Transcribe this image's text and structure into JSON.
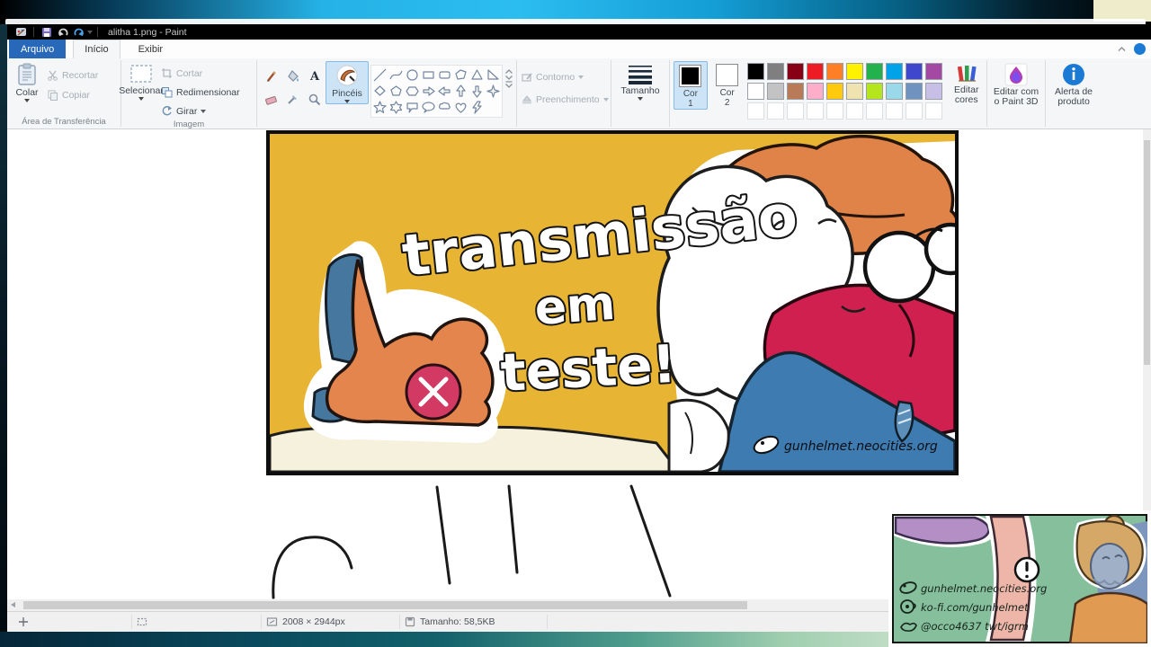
{
  "window": {
    "title": "alitha 1.png - Paint"
  },
  "tabs": {
    "file": "Arquivo",
    "home": "Início",
    "view": "Exibir"
  },
  "ribbon": {
    "clipboard": {
      "group_label": "Área de Transferência",
      "paste": "Colar",
      "cut": "Recortar",
      "copy": "Copiar"
    },
    "image": {
      "group_label": "Imagem",
      "select": "Selecionar",
      "crop": "Cortar",
      "resize": "Redimensionar",
      "rotate": "Girar"
    },
    "brushes": {
      "label": "Pincéis"
    },
    "shapes": {
      "outline": "Contorno",
      "fill": "Preenchimento"
    },
    "size": {
      "label": "Tamanho"
    },
    "colors": {
      "c1_label": "Cor",
      "c1_num": "1",
      "c2_label": "Cor",
      "c2_num": "2",
      "edit_label": "Editar cores",
      "color1": "#000000",
      "color2": "#ffffff",
      "palette": [
        [
          "#000000",
          "#7f7f7f",
          "#880015",
          "#ed1c24",
          "#ff7f27",
          "#fff200",
          "#22b14c",
          "#00a2e8",
          "#3f48cc",
          "#a349a4"
        ],
        [
          "#ffffff",
          "#c3c3c3",
          "#b97a57",
          "#ffaec9",
          "#ffc90e",
          "#efe4b0",
          "#b5e61d",
          "#99d9ea",
          "#7092be",
          "#c8bfe7"
        ]
      ],
      "empty_count": 10
    },
    "paint3d": {
      "label": "Editar com o Paint 3D"
    },
    "alert": {
      "label": "Alerta de produto"
    }
  },
  "artwork": {
    "word1": "transmissão",
    "word2": "em",
    "word3": "teste!",
    "signature": "gunhelmet.neocities.org",
    "bg_color": "#e8b434",
    "orange": "#e5854e",
    "crimson": "#cf2050",
    "blue": "#3d7bb0",
    "pink_circle": "#d23a64"
  },
  "status": {
    "dimensions": "2008 × 2944px",
    "file_size": "Tamanho: 58,5KB"
  },
  "overlay": {
    "line1": "gunhelmet.neocities.org",
    "line2": "ko-fi.com/gunhelmet",
    "line3": "@occo4637 twt/igrm",
    "bg_color": "#85bf9b"
  }
}
